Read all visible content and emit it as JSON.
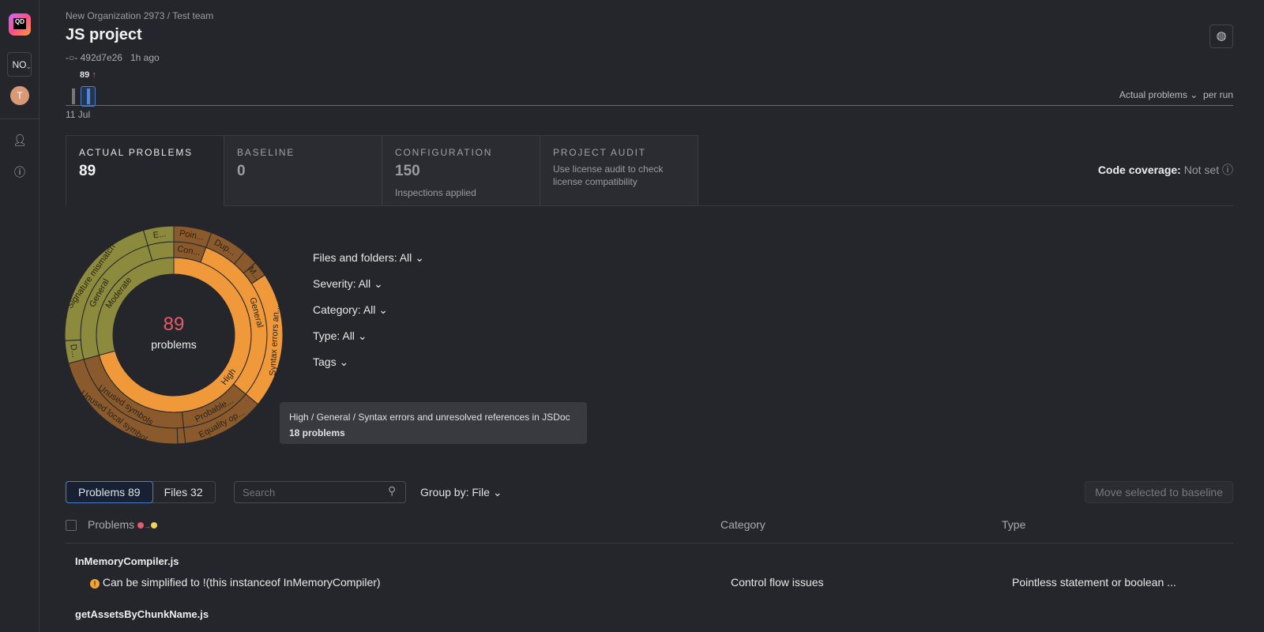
{
  "sidebar": {
    "logo": "QD",
    "org": "NO",
    "avatar": "T",
    "icons": [
      "user-icon",
      "help-icon"
    ]
  },
  "header": {
    "breadcrumb": "New Organization 2973 / Test team",
    "title": "JS project",
    "commit": "492d7e26",
    "time": "1h ago",
    "run_count": "89",
    "run_trend": "↑",
    "date": "11 Jul",
    "metric": "Actual problems",
    "metric_suffix": "per run"
  },
  "tabs": [
    {
      "label": "ACTUAL PROBLEMS",
      "value": "89"
    },
    {
      "label": "BASELINE",
      "value": "0"
    },
    {
      "label": "CONFIGURATION",
      "value": "150",
      "sub": "Inspections applied"
    },
    {
      "label": "PROJECT AUDIT",
      "sub": "Use license audit to check license compatibility"
    }
  ],
  "coverage": {
    "label": "Code coverage:",
    "value": "Not set"
  },
  "filters": [
    "Files and folders: All",
    "Severity: All",
    "Category: All",
    "Type: All",
    "Tags"
  ],
  "tooltip": {
    "path": "High / General / Syntax errors and unresolved references in JSDoc",
    "count": "18 problems"
  },
  "list": {
    "tab_problems": "Problems 89",
    "tab_files": "Files 32",
    "search_placeholder": "Search",
    "group_by": "Group by: File",
    "move_button": "Move selected to baseline",
    "columns": [
      "Problems",
      "Category",
      "Type"
    ],
    "groups": [
      {
        "file": "InMemoryCompiler.js",
        "problems": [
          {
            "text": "Can be simplified to !(this instanceof InMemoryCompiler)",
            "category": "Control flow issues",
            "type": "Pointless statement or boolean ..."
          }
        ]
      },
      {
        "file": "getAssetsByChunkName.js"
      }
    ]
  },
  "colors": {
    "high": "#f0993b",
    "moderate": "#8c8a3c",
    "brown": "#8a5a2c",
    "accent": "#4d7fc8",
    "total": "#e35d6a"
  },
  "chart_data": {
    "type": "sunburst",
    "total": "89",
    "total_label": "problems",
    "rings": [
      [
        {
          "label": "High",
          "value": 63,
          "color": "#f0993b"
        },
        {
          "label": "Moderate",
          "value": 26,
          "color": "#8c8a3c"
        }
      ],
      [
        {
          "label": "Con...",
          "value": 5,
          "color": "#8a5a2c"
        },
        {
          "label": "General",
          "value": 27,
          "color": "#f0993b"
        },
        {
          "label": "Probable...",
          "value": 11,
          "color": "#8a5a2c"
        },
        {
          "label": "Unused symbols",
          "value": 20,
          "color": "#8a5a2c"
        },
        {
          "label": "General",
          "value": 22,
          "color": "#8c8a3c"
        },
        {
          "label": "",
          "value": 4,
          "color": "#8c8a3c"
        }
      ],
      [
        {
          "label": "Poin...",
          "value": 5,
          "color": "#8a5a2c"
        },
        {
          "label": "Dup...",
          "value": 5,
          "color": "#8a5a2c"
        },
        {
          "label": "",
          "value": 2,
          "color": "#8a5a2c"
        },
        {
          "label": "M...",
          "value": 2,
          "color": "#8a5a2c"
        },
        {
          "label": "Syntax errors an...",
          "value": 18,
          "color": "#f0993b"
        },
        {
          "label": "Equality op...",
          "value": 11,
          "color": "#8a5a2c"
        },
        {
          "label": "",
          "value": 1,
          "color": "#8a5a2c"
        },
        {
          "label": "Unused local symbol",
          "value": 19,
          "color": "#8a5a2c"
        },
        {
          "label": "D...",
          "value": 3,
          "color": "#8c8a3c"
        },
        {
          "label": "Signature mismatch",
          "value": 19,
          "color": "#8c8a3c"
        },
        {
          "label": "E...",
          "value": 4,
          "color": "#8c8a3c"
        }
      ]
    ]
  }
}
